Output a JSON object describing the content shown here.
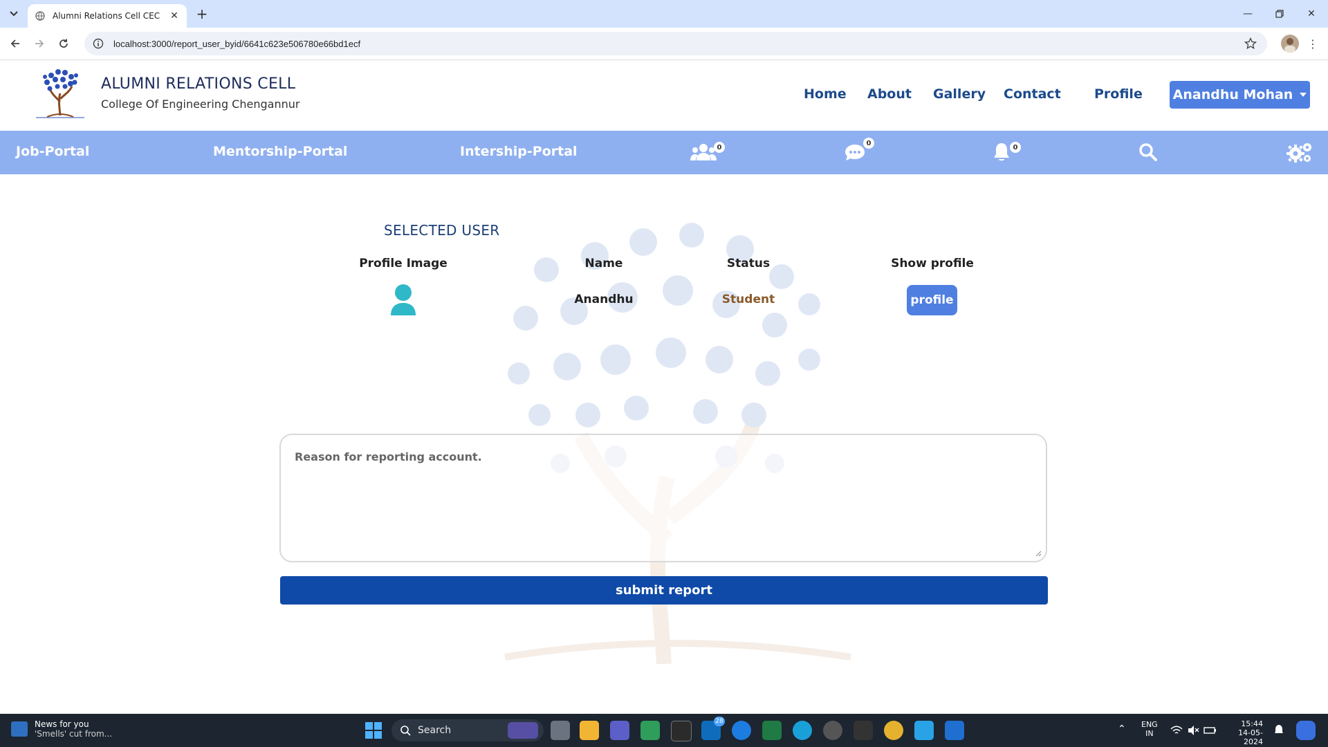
{
  "browser": {
    "tab_title": "Alumni Relations Cell CEC",
    "url": "localhost:3000/report_user_byid/6641c623e506780e66bd1ecf"
  },
  "header": {
    "title": "ALUMNI RELATIONS CELL",
    "subtitle": "College Of Engineering Chengannur",
    "nav": {
      "home": "Home",
      "about": "About",
      "gallery": "Gallery",
      "contact": "Contact",
      "profile": "Profile"
    },
    "user_menu": "Anandhu Mohan"
  },
  "portal_bar": {
    "job": "Job-Portal",
    "mentorship": "Mentorship-Portal",
    "internship": "Intership-Portal",
    "friend_requests_count": "0",
    "messages_count": "0",
    "notifications_count": "0"
  },
  "selected_user": {
    "section_title": "SELECTED USER",
    "columns": {
      "image": "Profile Image",
      "name": "Name",
      "status": "Status",
      "show": "Show profile"
    },
    "row": {
      "name": "Anandhu",
      "status": "Student",
      "profile_button": "profile"
    }
  },
  "report": {
    "placeholder": "Reason for reporting account.",
    "submit": "submit report"
  },
  "taskbar": {
    "news_title": "News for you",
    "news_sub": "'Smells' cut from...",
    "search": "Search",
    "mail_badge": "28",
    "lang_top": "ENG",
    "lang_bottom": "IN",
    "time": "15:44",
    "date": "14-05-2024"
  },
  "colors": {
    "brand_blue": "#1c4a8b",
    "portal_bar": "#8fb0f0",
    "button_blue": "#4f7fe0",
    "submit_blue": "#0f4aa8",
    "status_brown": "#8a5a2b",
    "user_icon": "#2fb8c8"
  }
}
